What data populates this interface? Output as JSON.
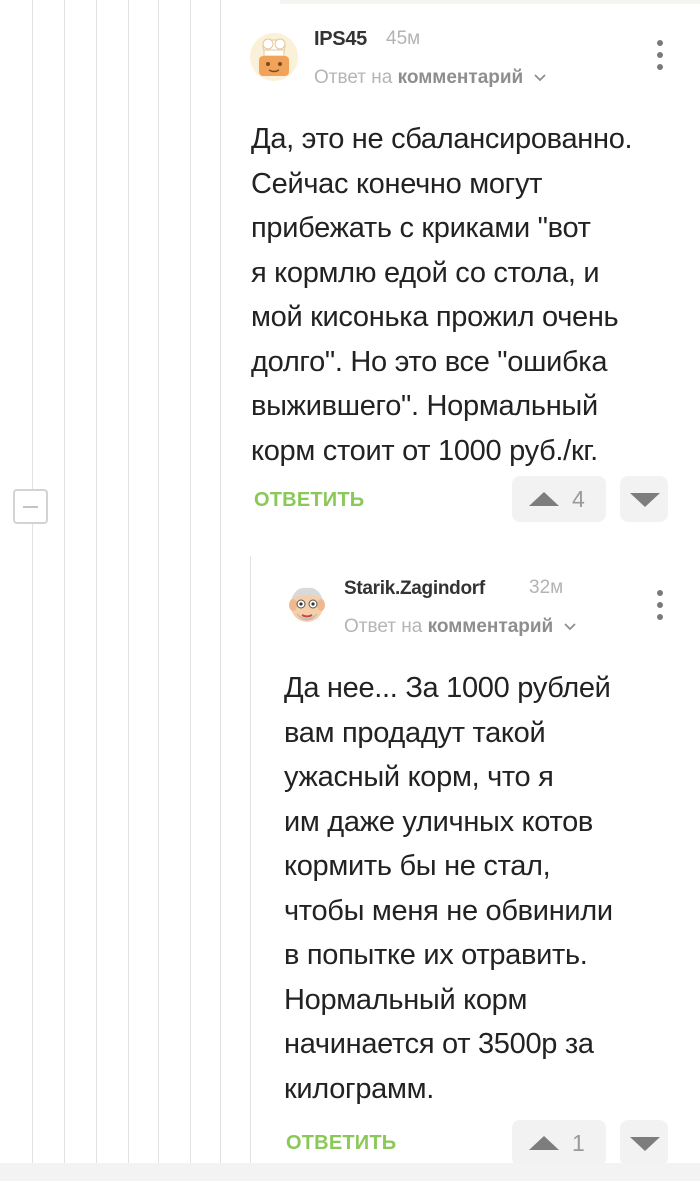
{
  "comments": [
    {
      "author": "IPS45",
      "time": "45м",
      "reply_prefix": "Ответ на",
      "reply_target": "комментарий",
      "avatar_icon": "hat-avatar-icon",
      "text_lines": [
        "Да, это не сбалансированно.",
        "Сейчас конечно могут",
        "прибежать с криками \"вот",
        "я кормлю едой со стола, и",
        "мой кисонька прожил очень",
        "долго\". Но это все \"ошибка",
        "выжившего\". Нормальный",
        "корм стоит от 1000 руб./кг."
      ],
      "reply_label": "ОТВЕТИТЬ",
      "rating": "4"
    },
    {
      "author": "Starik.Zagindorf",
      "time": "32м",
      "reply_prefix": "Ответ на",
      "reply_target": "комментарий",
      "avatar_icon": "old-man-avatar-icon",
      "text_lines": [
        "Да нее... За 1000 рублей",
        "вам продадут такой",
        "ужасный корм, что я",
        "им даже уличных котов",
        "кормить бы не стал,",
        "чтобы меня не обвинили",
        "в попытке их отравить.",
        "Нормальный корм",
        "начинается от 3500р за",
        "килограмм."
      ],
      "reply_label": "ОТВЕТИТЬ",
      "rating": "1"
    }
  ],
  "colors": {
    "reply_green": "#8ac858",
    "thread_line": "#e2e2e2",
    "vote_bg": "#f2f2f2"
  }
}
